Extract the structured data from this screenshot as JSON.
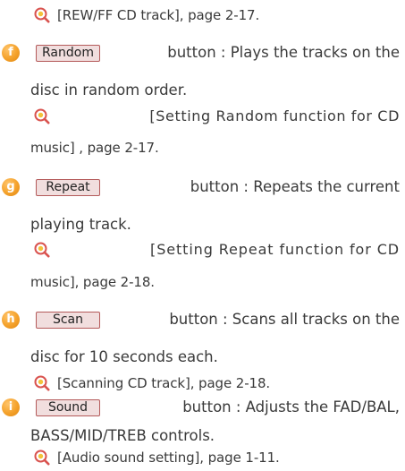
{
  "line0": {
    "text": "[REW/FF CD track], page 2-17."
  },
  "items": [
    {
      "marker": "f",
      "button": "Random",
      "desc_first": "button : Plays the tracks on the",
      "desc_rest": "disc in random order.",
      "ref1": "[Setting Random function for CD",
      "ref2": "music] , page 2-17."
    },
    {
      "marker": "g",
      "button": "Repeat",
      "desc_first": "button : Repeats the current",
      "desc_rest": "playing track.",
      "ref1": "[Setting Repeat function for CD",
      "ref2": "music], page 2-18."
    },
    {
      "marker": "h",
      "button": "Scan",
      "desc_first": "button : Scans all tracks on the",
      "desc_rest": "disc for 10 seconds each.",
      "ref": "[Scanning CD track], page 2-18."
    },
    {
      "marker": "i",
      "button": "Sound",
      "desc_first": "button : Adjusts the FAD/BAL,",
      "desc_rest": "BASS/MID/TREB controls.",
      "ref": "[Audio sound setting], page 1-11."
    }
  ],
  "colors": {
    "marker": "#f4a12a",
    "button_bg": "#f1dede",
    "button_border": "#b45a5a",
    "text": "#3a3a3a"
  },
  "icons": {
    "marker": "orange-circle-letter",
    "reference": "magnifier-icon"
  }
}
